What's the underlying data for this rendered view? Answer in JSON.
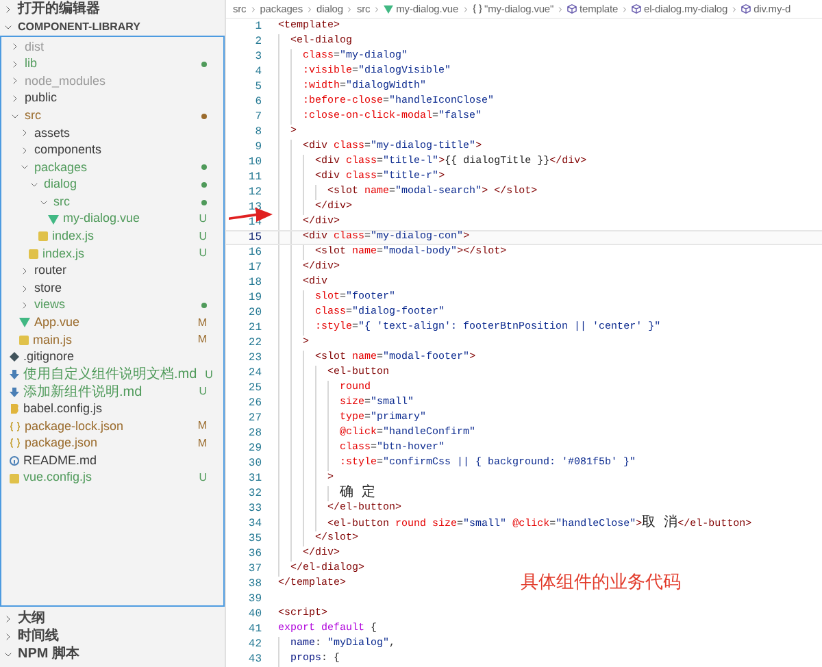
{
  "sidebar": {
    "sections_top": [
      {
        "title": "打开的编辑器",
        "expanded": false
      },
      {
        "title": "COMPONENT-LIBRARY",
        "expanded": true
      }
    ],
    "tree": [
      {
        "name": "dist",
        "kind": "folder",
        "expanded": false,
        "dot": false,
        "color": "#9a9a9a"
      },
      {
        "name": "lib",
        "kind": "folder",
        "expanded": false,
        "dot": true,
        "color": "#4f9a5a"
      },
      {
        "name": "node_modules",
        "kind": "folder",
        "expanded": false,
        "dot": false,
        "color": "#9a9a9a"
      },
      {
        "name": "public",
        "kind": "folder",
        "expanded": false,
        "dot": false,
        "color": "#3b3b3b"
      },
      {
        "name": "src",
        "kind": "folder",
        "expanded": true,
        "dot": true,
        "color": "#9a6b2c",
        "children": [
          {
            "name": "assets",
            "kind": "folder",
            "expanded": false,
            "dot": false,
            "color": "#3b3b3b"
          },
          {
            "name": "components",
            "kind": "folder",
            "expanded": false,
            "dot": false,
            "color": "#3b3b3b"
          },
          {
            "name": "packages",
            "kind": "folder",
            "expanded": true,
            "dot": true,
            "color": "#4f9a5a",
            "children": [
              {
                "name": "dialog",
                "kind": "folder",
                "expanded": true,
                "dot": true,
                "color": "#4f9a5a",
                "children": [
                  {
                    "name": "src",
                    "kind": "folder",
                    "expanded": true,
                    "dot": true,
                    "color": "#4f9a5a",
                    "children": [
                      {
                        "name": "my-dialog.vue",
                        "kind": "vue",
                        "color": "#4f9a5a",
                        "badge": "U"
                      }
                    ]
                  },
                  {
                    "name": "index.js",
                    "kind": "js",
                    "color": "#4f9a5a",
                    "badge": "U"
                  }
                ]
              },
              {
                "name": "index.js",
                "kind": "js",
                "color": "#4f9a5a",
                "badge": "U"
              }
            ]
          },
          {
            "name": "router",
            "kind": "folder",
            "expanded": false,
            "dot": false,
            "color": "#3b3b3b"
          },
          {
            "name": "store",
            "kind": "folder",
            "expanded": false,
            "dot": false,
            "color": "#3b3b3b"
          },
          {
            "name": "views",
            "kind": "folder",
            "expanded": false,
            "dot": true,
            "color": "#4f9a5a"
          },
          {
            "name": "App.vue",
            "kind": "vue",
            "color": "#9a6b2c",
            "badge": "M"
          },
          {
            "name": "main.js",
            "kind": "js",
            "color": "#9a6b2c",
            "badge": "M"
          }
        ]
      },
      {
        "name": ".gitignore",
        "kind": "git",
        "color": "#3b3b3b"
      },
      {
        "name": "使用自定义组件说明文档.md",
        "kind": "md",
        "color": "#4f9a5a",
        "badge": "U"
      },
      {
        "name": "添加新组件说明.md",
        "kind": "md",
        "color": "#4f9a5a",
        "badge": "U"
      },
      {
        "name": "babel.config.js",
        "kind": "babel",
        "color": "#3b3b3b"
      },
      {
        "name": "package-lock.json",
        "kind": "json",
        "color": "#9a6b2c",
        "badge": "M"
      },
      {
        "name": "package.json",
        "kind": "json",
        "color": "#9a6b2c",
        "badge": "M"
      },
      {
        "name": "README.md",
        "kind": "info",
        "color": "#3b3b3b"
      },
      {
        "name": "vue.config.js",
        "kind": "js",
        "color": "#4f9a5a",
        "badge": "U"
      }
    ],
    "sections_bottom": [
      {
        "title": "大纲",
        "expanded": false
      },
      {
        "title": "时间线",
        "expanded": false
      },
      {
        "title": "NPM 脚本",
        "expanded": true
      }
    ]
  },
  "breadcrumb": [
    {
      "kind": "folder",
      "text": "src"
    },
    {
      "kind": "folder",
      "text": "packages"
    },
    {
      "kind": "folder",
      "text": "dialog"
    },
    {
      "kind": "folder",
      "text": "src"
    },
    {
      "kind": "vue",
      "text": "my-dialog.vue"
    },
    {
      "kind": "module",
      "text": "\"my-dialog.vue\""
    },
    {
      "kind": "element",
      "text": "template"
    },
    {
      "kind": "element",
      "text": "el-dialog.my-dialog"
    },
    {
      "kind": "element",
      "text": "div.my-d"
    }
  ],
  "editor": {
    "lines": [
      {
        "number": "1",
        "current": false,
        "tokens": [
          {
            "kind": "tag",
            "text": "<template>"
          }
        ]
      },
      {
        "number": "2",
        "current": false,
        "tokens": [
          {
            "kind": "tag",
            "text": "  <el-dialog"
          }
        ]
      },
      {
        "number": "3",
        "current": false,
        "tokens": [
          {
            "kind": "attr",
            "text": "    class"
          },
          {
            "kind": "punct",
            "text": "="
          },
          {
            "kind": "string",
            "text": "\"my-dialog\""
          }
        ]
      },
      {
        "number": "4",
        "current": false,
        "tokens": [
          {
            "kind": "attr",
            "text": "    :visible"
          },
          {
            "kind": "punct",
            "text": "="
          },
          {
            "kind": "string",
            "text": "\"dialogVisible\""
          }
        ]
      },
      {
        "number": "5",
        "current": false,
        "tokens": [
          {
            "kind": "attr",
            "text": "    :width"
          },
          {
            "kind": "punct",
            "text": "="
          },
          {
            "kind": "string",
            "text": "\"dialogWidth\""
          }
        ]
      },
      {
        "number": "6",
        "current": false,
        "tokens": [
          {
            "kind": "attr",
            "text": "    :before-close"
          },
          {
            "kind": "punct",
            "text": "="
          },
          {
            "kind": "string",
            "text": "\"handleIconClose\""
          }
        ]
      },
      {
        "number": "7",
        "current": false,
        "tokens": [
          {
            "kind": "attr",
            "text": "    :close-on-click-modal"
          },
          {
            "kind": "punct",
            "text": "="
          },
          {
            "kind": "string",
            "text": "\"false\""
          }
        ]
      },
      {
        "number": "8",
        "current": false,
        "tokens": [
          {
            "kind": "tag",
            "text": "  >"
          }
        ]
      },
      {
        "number": "9",
        "current": false,
        "tokens": [
          {
            "kind": "tag",
            "text": "    <div"
          },
          {
            "kind": "attr",
            "text": " class"
          },
          {
            "kind": "punct",
            "text": "="
          },
          {
            "kind": "string",
            "text": "\"my-dialog-title\""
          },
          {
            "kind": "tag",
            "text": ">"
          }
        ]
      },
      {
        "number": "10",
        "current": false,
        "tokens": [
          {
            "kind": "tag",
            "text": "      <div"
          },
          {
            "kind": "attr",
            "text": " class"
          },
          {
            "kind": "punct",
            "text": "="
          },
          {
            "kind": "string",
            "text": "\"title-l\""
          },
          {
            "kind": "tag",
            "text": ">"
          },
          {
            "kind": "text",
            "text": "{{ dialogTitle }}"
          },
          {
            "kind": "tag",
            "text": "</div>"
          }
        ]
      },
      {
        "number": "11",
        "current": false,
        "tokens": [
          {
            "kind": "tag",
            "text": "      <div"
          },
          {
            "kind": "attr",
            "text": " class"
          },
          {
            "kind": "punct",
            "text": "="
          },
          {
            "kind": "string",
            "text": "\"title-r\""
          },
          {
            "kind": "tag",
            "text": ">"
          }
        ]
      },
      {
        "number": "12",
        "current": false,
        "tokens": [
          {
            "kind": "tag",
            "text": "        <slot"
          },
          {
            "kind": "attr",
            "text": " name"
          },
          {
            "kind": "punct",
            "text": "="
          },
          {
            "kind": "string",
            "text": "\"modal-search\""
          },
          {
            "kind": "tag",
            "text": "> </slot>"
          }
        ]
      },
      {
        "number": "13",
        "current": false,
        "tokens": [
          {
            "kind": "tag",
            "text": "      </div>"
          }
        ]
      },
      {
        "number": "14",
        "current": false,
        "tokens": [
          {
            "kind": "tag",
            "text": "    </div>"
          }
        ]
      },
      {
        "number": "15",
        "current": true,
        "tokens": [
          {
            "kind": "tag",
            "text": "    <div"
          },
          {
            "kind": "attr",
            "text": " class"
          },
          {
            "kind": "punct",
            "text": "="
          },
          {
            "kind": "string",
            "text": "\"my-dialog-con\""
          },
          {
            "kind": "tag",
            "text": ">"
          }
        ]
      },
      {
        "number": "16",
        "current": false,
        "tokens": [
          {
            "kind": "tag",
            "text": "      <slot"
          },
          {
            "kind": "attr",
            "text": " name"
          },
          {
            "kind": "punct",
            "text": "="
          },
          {
            "kind": "string",
            "text": "\"modal-body\""
          },
          {
            "kind": "tag",
            "text": "></slot>"
          }
        ]
      },
      {
        "number": "17",
        "current": false,
        "tokens": [
          {
            "kind": "tag",
            "text": "    </div>"
          }
        ]
      },
      {
        "number": "18",
        "current": false,
        "tokens": [
          {
            "kind": "tag",
            "text": "    <div"
          }
        ]
      },
      {
        "number": "19",
        "current": false,
        "tokens": [
          {
            "kind": "attr",
            "text": "      slot"
          },
          {
            "kind": "punct",
            "text": "="
          },
          {
            "kind": "string",
            "text": "\"footer\""
          }
        ]
      },
      {
        "number": "20",
        "current": false,
        "tokens": [
          {
            "kind": "attr",
            "text": "      class"
          },
          {
            "kind": "punct",
            "text": "="
          },
          {
            "kind": "string",
            "text": "\"dialog-footer\""
          }
        ]
      },
      {
        "number": "21",
        "current": false,
        "tokens": [
          {
            "kind": "attr",
            "text": "      :style"
          },
          {
            "kind": "punct",
            "text": "="
          },
          {
            "kind": "string",
            "text": "\"{ 'text-align': footerBtnPosition || 'center' }\""
          }
        ]
      },
      {
        "number": "22",
        "current": false,
        "tokens": [
          {
            "kind": "tag",
            "text": "    >"
          }
        ]
      },
      {
        "number": "23",
        "current": false,
        "tokens": [
          {
            "kind": "tag",
            "text": "      <slot"
          },
          {
            "kind": "attr",
            "text": " name"
          },
          {
            "kind": "punct",
            "text": "="
          },
          {
            "kind": "string",
            "text": "\"modal-footer\""
          },
          {
            "kind": "tag",
            "text": ">"
          }
        ]
      },
      {
        "number": "24",
        "current": false,
        "tokens": [
          {
            "kind": "tag",
            "text": "        <el-button"
          }
        ]
      },
      {
        "number": "25",
        "current": false,
        "tokens": [
          {
            "kind": "attr",
            "text": "          round"
          }
        ]
      },
      {
        "number": "26",
        "current": false,
        "tokens": [
          {
            "kind": "attr",
            "text": "          size"
          },
          {
            "kind": "punct",
            "text": "="
          },
          {
            "kind": "string",
            "text": "\"small\""
          }
        ]
      },
      {
        "number": "27",
        "current": false,
        "tokens": [
          {
            "kind": "attr",
            "text": "          type"
          },
          {
            "kind": "punct",
            "text": "="
          },
          {
            "kind": "string",
            "text": "\"primary\""
          }
        ]
      },
      {
        "number": "28",
        "current": false,
        "tokens": [
          {
            "kind": "attr",
            "text": "          @click"
          },
          {
            "kind": "punct",
            "text": "="
          },
          {
            "kind": "string",
            "text": "\"handleConfirm\""
          }
        ]
      },
      {
        "number": "29",
        "current": false,
        "tokens": [
          {
            "kind": "attr",
            "text": "          class"
          },
          {
            "kind": "punct",
            "text": "="
          },
          {
            "kind": "string",
            "text": "\"btn-hover\""
          }
        ]
      },
      {
        "number": "30",
        "current": false,
        "tokens": [
          {
            "kind": "attr",
            "text": "          :style"
          },
          {
            "kind": "punct",
            "text": "="
          },
          {
            "kind": "string",
            "text": "\"confirmCss || { background: '#081f5b' }\""
          }
        ]
      },
      {
        "number": "31",
        "current": false,
        "tokens": [
          {
            "kind": "tag",
            "text": "        >"
          }
        ]
      },
      {
        "number": "32",
        "current": false,
        "tokens": [
          {
            "kind": "text",
            "text": "          确 定"
          }
        ]
      },
      {
        "number": "33",
        "current": false,
        "tokens": [
          {
            "kind": "tag",
            "text": "        </el-button>"
          }
        ]
      },
      {
        "number": "34",
        "current": false,
        "tokens": [
          {
            "kind": "tag",
            "text": "        <el-button"
          },
          {
            "kind": "attr",
            "text": " round size"
          },
          {
            "kind": "punct",
            "text": "="
          },
          {
            "kind": "string",
            "text": "\"small\""
          },
          {
            "kind": "attr",
            "text": " @click"
          },
          {
            "kind": "punct",
            "text": "="
          },
          {
            "kind": "string",
            "text": "\"handleClose\""
          },
          {
            "kind": "tag",
            "text": ">"
          },
          {
            "kind": "text",
            "text": "取 消"
          },
          {
            "kind": "tag",
            "text": "</el-button>"
          }
        ]
      },
      {
        "number": "35",
        "current": false,
        "tokens": [
          {
            "kind": "tag",
            "text": "      </slot>"
          }
        ]
      },
      {
        "number": "36",
        "current": false,
        "tokens": [
          {
            "kind": "tag",
            "text": "    </div>"
          }
        ]
      },
      {
        "number": "37",
        "current": false,
        "tokens": [
          {
            "kind": "tag",
            "text": "  </el-dialog>"
          }
        ]
      },
      {
        "number": "38",
        "current": false,
        "tokens": [
          {
            "kind": "tag",
            "text": "</template>"
          }
        ]
      },
      {
        "number": "39",
        "current": false
      },
      {
        "number": "40",
        "current": false,
        "tokens": [
          {
            "kind": "tag",
            "text": "<script>"
          }
        ]
      },
      {
        "number": "41",
        "current": false,
        "tokens": [
          {
            "kind": "keyword",
            "text": "export default"
          },
          {
            "kind": "punct",
            "text": " {"
          }
        ]
      },
      {
        "number": "42",
        "current": false,
        "tokens": [
          {
            "kind": "property",
            "text": "  name"
          },
          {
            "kind": "punct",
            "text": ": "
          },
          {
            "kind": "string",
            "text": "\"myDialog\""
          },
          {
            "kind": "punct",
            "text": ","
          }
        ]
      },
      {
        "number": "43",
        "current": false,
        "tokens": [
          {
            "kind": "property",
            "text": "  props"
          },
          {
            "kind": "punct",
            "text": ": {"
          }
        ]
      }
    ]
  },
  "annotation": {
    "text": "具体组件的业务代码"
  }
}
